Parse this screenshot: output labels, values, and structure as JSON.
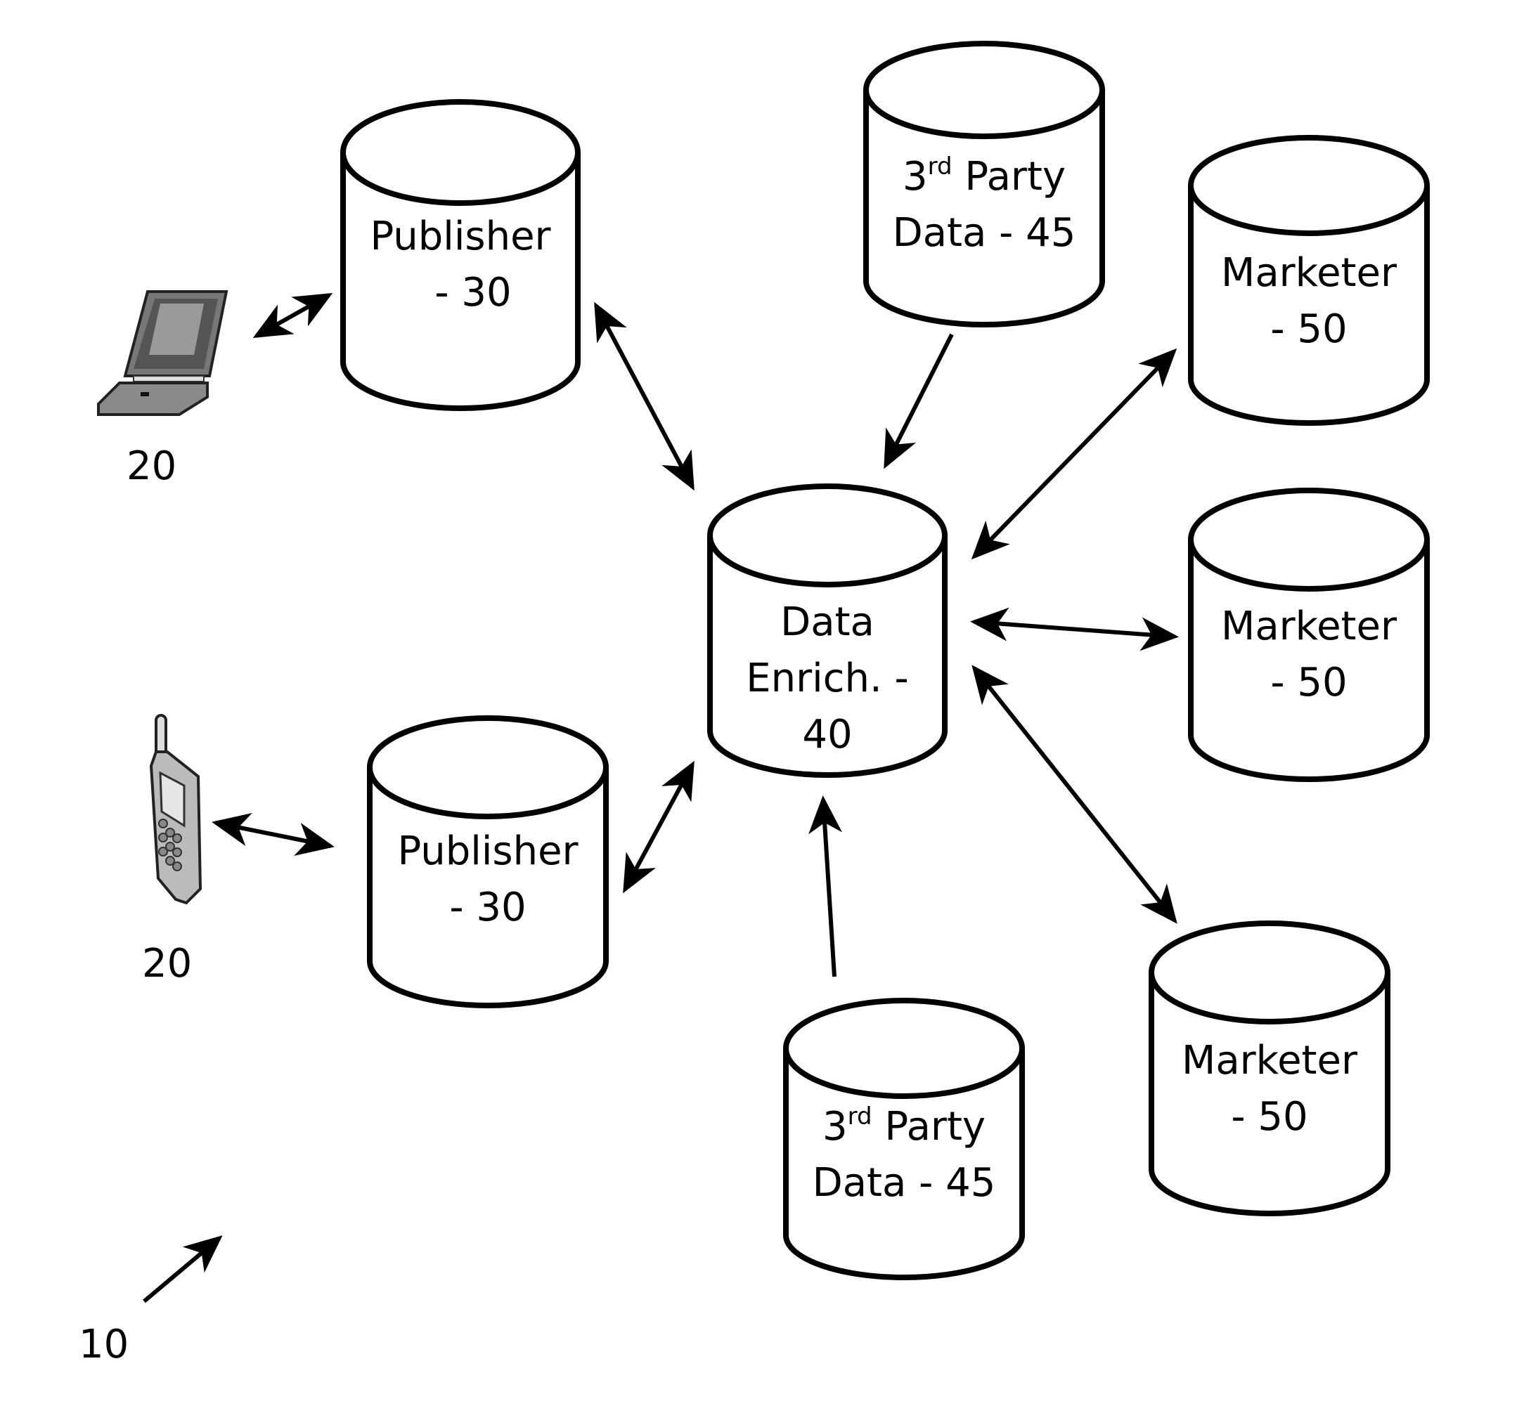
{
  "figure": {
    "system_ref": "10",
    "devices": [
      {
        "type": "laptop",
        "icon": "laptop-icon",
        "ref": "20"
      },
      {
        "type": "mobile-phone",
        "icon": "phone-icon",
        "ref": "20"
      }
    ],
    "nodes": {
      "publisher_top": {
        "line1": "Publisher",
        "line2": "- 30"
      },
      "publisher_bottom": {
        "line1": "Publisher",
        "line2": "- 30"
      },
      "third_party_top": {
        "line1_num": "3",
        "line1_sup": "rd",
        "line1_rest": " Party",
        "line2": "Data - 45"
      },
      "third_party_bottom": {
        "line1_num": "3",
        "line1_sup": "rd",
        "line1_rest": " Party",
        "line2": "Data - 45"
      },
      "data_enrichment": {
        "line1": "Data",
        "line2": "Enrich. -",
        "line3": "40"
      },
      "marketer_1": {
        "line1": "Marketer",
        "line2": "- 50"
      },
      "marketer_2": {
        "line1": "Marketer",
        "line2": "- 50"
      },
      "marketer_3": {
        "line1": "Marketer",
        "line2": "- 50"
      }
    },
    "connections": [
      {
        "from": "laptop",
        "to": "publisher_top",
        "direction": "bidirectional"
      },
      {
        "from": "phone",
        "to": "publisher_bottom",
        "direction": "bidirectional"
      },
      {
        "from": "publisher_top",
        "to": "data_enrichment",
        "direction": "bidirectional"
      },
      {
        "from": "publisher_bottom",
        "to": "data_enrichment",
        "direction": "bidirectional"
      },
      {
        "from": "third_party_top",
        "to": "data_enrichment",
        "direction": "one-way"
      },
      {
        "from": "third_party_bottom",
        "to": "data_enrichment",
        "direction": "one-way"
      },
      {
        "from": "data_enrichment",
        "to": "marketer_1",
        "direction": "bidirectional"
      },
      {
        "from": "data_enrichment",
        "to": "marketer_2",
        "direction": "bidirectional"
      },
      {
        "from": "data_enrichment",
        "to": "marketer_3",
        "direction": "bidirectional"
      }
    ]
  }
}
